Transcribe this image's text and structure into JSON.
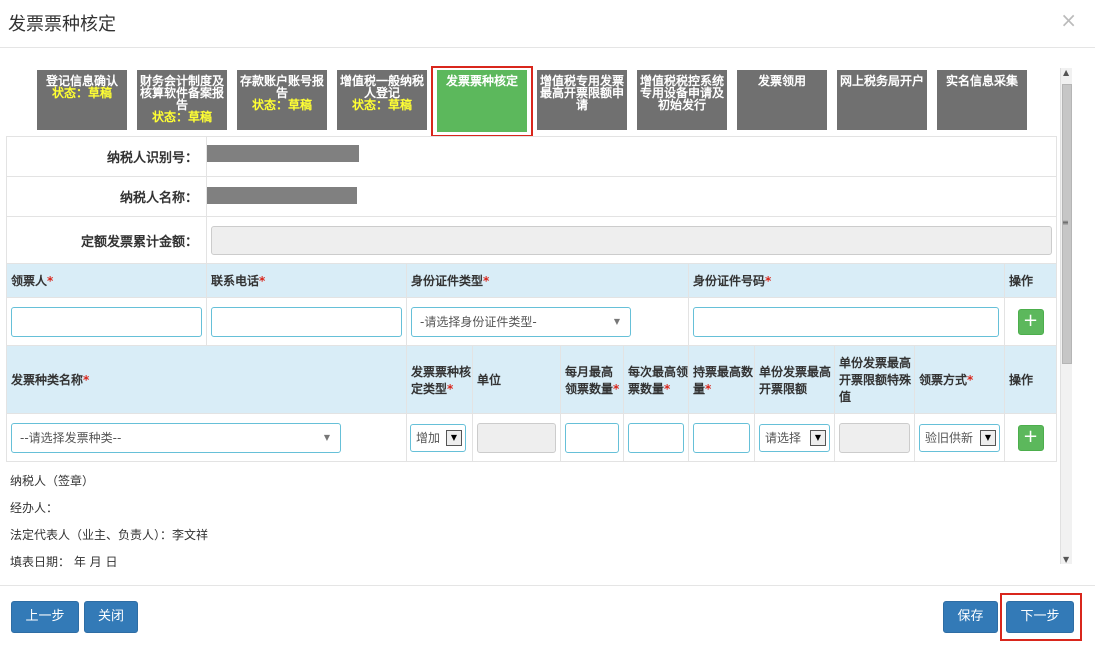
{
  "dialog": {
    "title": "发票票种核定",
    "close_glyph": "×"
  },
  "steps": [
    {
      "label": "登记信息确认",
      "status": "状态：草稿"
    },
    {
      "label": "财务会计制度及核算软件备案报告",
      "status": "状态：草稿"
    },
    {
      "label": "存款账户账号报告",
      "status": "状态：草稿"
    },
    {
      "label": "增值税一般纳税人登记",
      "status": "状态：草稿"
    },
    {
      "label": "发票票种核定",
      "status": ""
    },
    {
      "label": "增值税专用发票最高开票限额申请",
      "status": ""
    },
    {
      "label": "增值税税控系统专用设备申请及初始发行",
      "status": ""
    },
    {
      "label": "发票领用",
      "status": ""
    },
    {
      "label": "网上税务局开户",
      "status": ""
    },
    {
      "label": "实名信息采集",
      "status": ""
    }
  ],
  "taxpayer": {
    "id_label": "纳税人识别号：",
    "name_label": "纳税人名称：",
    "amount_label": "定额发票累计金额："
  },
  "recipient_table": {
    "headers": [
      "领票人",
      "联系电话",
      "身份证件类型",
      "身份证件号码",
      "操作"
    ],
    "required_mark": "*",
    "id_type_placeholder": "-请选择身份证件类型-",
    "add_glyph": "+"
  },
  "invoice_table": {
    "headers": {
      "name": "发票种类名称",
      "type": "发票票种核定类型",
      "unit": "单位",
      "monthly": "每月最高领票数量",
      "each": "每次最高领票数量",
      "hold": "持票最高数量",
      "limit": "单份发票最高开票限额",
      "special": "单份发票最高开票限额特殊值",
      "method": "领票方式",
      "op": "操作"
    },
    "name_placeholder": "--请选择发票种类--",
    "type_value": "增加",
    "limit_value": "请选择",
    "method_value": "验旧供新",
    "add_glyph": "+"
  },
  "notes": [
    "纳税人（签章）",
    "经办人：",
    "法定代表人（业主、负责人）：李文祥",
    "填表日期：    年  月  日"
  ],
  "footer": {
    "prev": "上一步",
    "close": "关闭",
    "save": "保存",
    "next": "下一步"
  }
}
